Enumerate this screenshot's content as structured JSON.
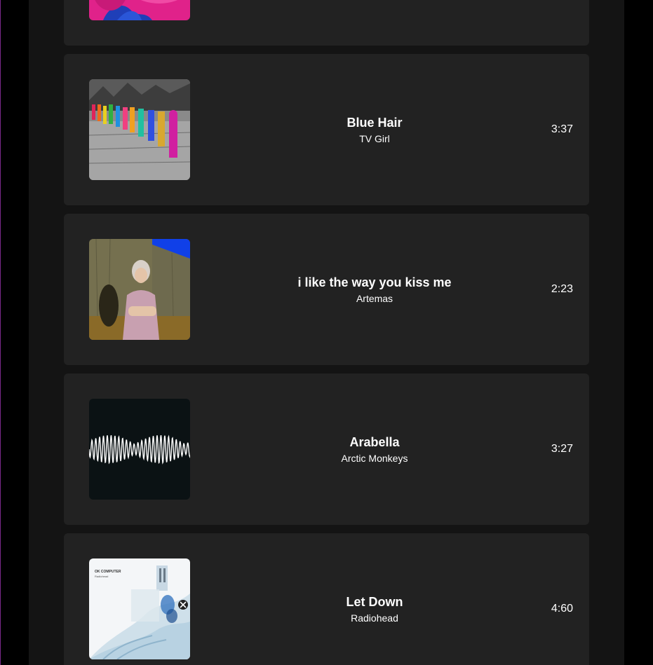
{
  "tracks": [
    {
      "title": "",
      "artist": "",
      "duration": "",
      "art": "pink-blue-cover-art"
    },
    {
      "title": "Blue Hair",
      "artist": "TV Girl",
      "duration": "3:37",
      "art": "rainbow-dancers-cover-art"
    },
    {
      "title": "i like the way you kiss me",
      "artist": "Artemas",
      "duration": "2:23",
      "art": "girl-by-wall-cover-art"
    },
    {
      "title": "Arabella",
      "artist": "Arctic Monkeys",
      "duration": "3:27",
      "art": "soundwave-cover-art"
    },
    {
      "title": "Let Down",
      "artist": "Radiohead",
      "duration": "4:60",
      "art": "ok-computer-cover-art",
      "cover_text": {
        "line1": "OK COMPUTER",
        "line2": "Radiohead"
      }
    }
  ],
  "colors": {
    "background": "#000000",
    "panel": "#141414",
    "card": "#222222",
    "text": "#ffffff",
    "accent_edge": "#7a2a8c"
  }
}
